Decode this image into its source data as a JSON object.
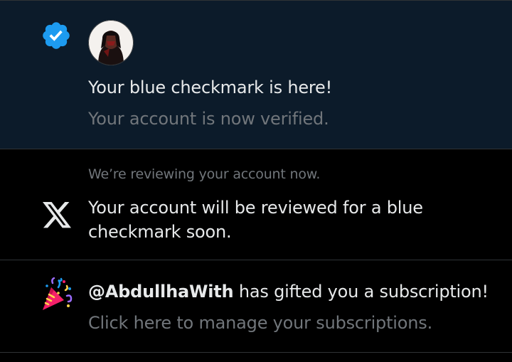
{
  "colors": {
    "background": "#000000",
    "unread_background": "#0c1b2a",
    "primary_text": "#e7e9ea",
    "secondary_text": "#71767b",
    "divider": "#2f3336",
    "verified_blue": "#1d9bf0"
  },
  "notifications": [
    {
      "icon": "verified-badge-icon",
      "avatar": "user-avatar",
      "title": "Your blue checkmark is here!",
      "subtitle": "Your account is now verified."
    },
    {
      "icon": "x-logo-icon",
      "header": "We’re reviewing your account now.",
      "body": "Your account will be reviewed for a blue checkmark soon."
    },
    {
      "icon": "party-popper-icon",
      "handle": "@AbdullhaWith",
      "title_rest": " has gifted you a subscription!",
      "subtitle": "Click here to manage your subscriptions."
    }
  ]
}
